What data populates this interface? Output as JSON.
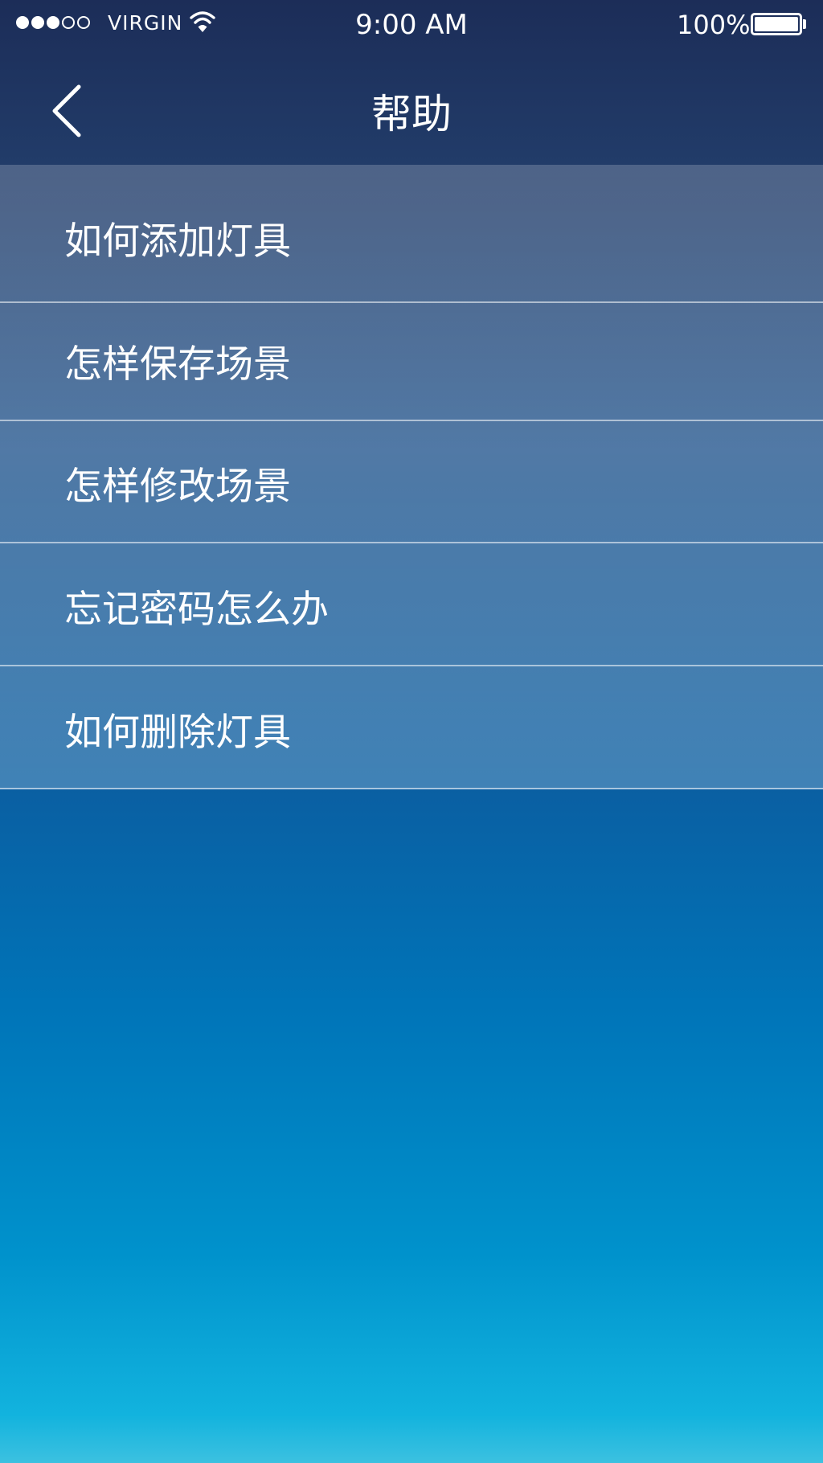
{
  "status_bar": {
    "signal_filled": 3,
    "signal_total": 5,
    "carrier": "VIRGIN",
    "wifi_icon": "wifi-icon",
    "time": "9:00 AM",
    "battery_percent": "100%",
    "battery_level": 1.0
  },
  "nav": {
    "back_icon": "chevron-left-icon",
    "title": "帮助"
  },
  "help_items": [
    {
      "label": "如何添加灯具"
    },
    {
      "label": "怎样保存场景"
    },
    {
      "label": "怎样修改场景"
    },
    {
      "label": "忘记密码怎么办"
    },
    {
      "label": "如何删除灯具"
    }
  ],
  "colors": {
    "text": "#ffffff",
    "nav_background": "#1c2d58",
    "background_bottom": "#12b3de"
  }
}
